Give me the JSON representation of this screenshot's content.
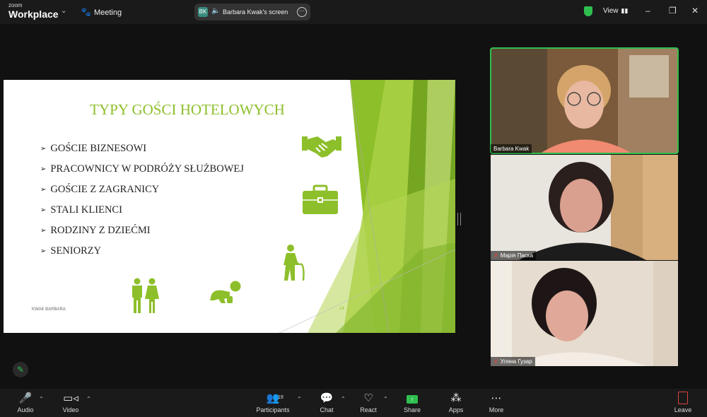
{
  "app": {
    "logo_small": "zoom",
    "logo_big": "Workplace",
    "meeting_label": "Meeting"
  },
  "share_pill": {
    "initials": "BK",
    "label": "Barbara Kwak's screen"
  },
  "view_label": "View",
  "window_controls": [
    "–",
    "❐",
    "✕"
  ],
  "slide": {
    "title": "TYPY GOŚCI HOTELOWYCH",
    "bullets": [
      "GOŚCIE BIZNESOWI",
      "PRACOWNICY W PODRÓŻY SŁUŻBOWEJ",
      "GOŚCIE Z ZAGRANICY",
      "STALI KLIENCI",
      "RODZINY Z DZIEĆMI",
      "SENIORZY"
    ],
    "footer": "KWAK BARBARA",
    "page": "14",
    "accent": "#8dbf2a"
  },
  "participants": [
    {
      "name": "Barbara Kwak",
      "muted": false
    },
    {
      "name": "Марія Паска",
      "muted": true
    },
    {
      "name": "Уляна Гузар",
      "muted": true
    }
  ],
  "toolbar": {
    "audio": "Audio",
    "video": "Video",
    "participants": "Participants",
    "participants_count": "19",
    "chat": "Chat",
    "react": "React",
    "share": "Share",
    "apps": "Apps",
    "more": "More",
    "leave": "Leave"
  },
  "colors": {
    "accent_green": "#2fbf4f",
    "danger": "#e0443e"
  }
}
